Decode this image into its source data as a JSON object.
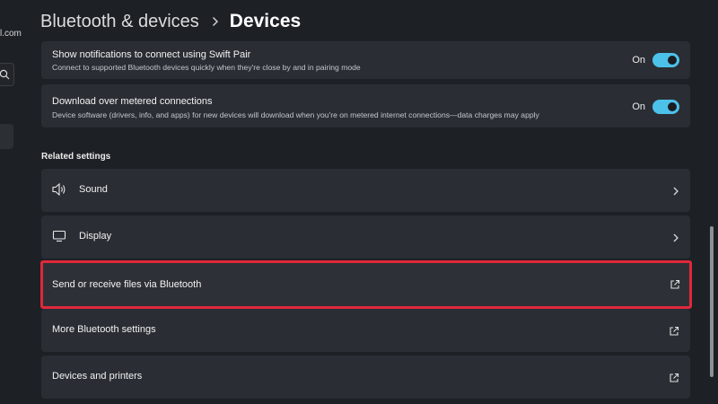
{
  "sidebar": {
    "account_email_fragment": "l.com",
    "search_icon": "search-icon"
  },
  "header": {
    "parent": "Bluetooth & devices",
    "separator_icon": "chevron-right-icon",
    "current": "Devices"
  },
  "toggle_settings": [
    {
      "title": "Show notifications to connect using Swift Pair",
      "description": "Connect to supported Bluetooth devices quickly when they're close by and in pairing mode",
      "state": "On"
    },
    {
      "title": "Download over metered connections",
      "description": "Device software (drivers, info, and apps) for new devices will download when you're on metered internet connections—data charges may apply",
      "state": "On"
    }
  ],
  "related_settings": {
    "title": "Related settings",
    "items": [
      {
        "label": "Sound",
        "icon": "speaker-icon",
        "end_icon": "chevron-right-icon"
      },
      {
        "label": "Display",
        "icon": "monitor-icon",
        "end_icon": "chevron-right-icon"
      },
      {
        "label": "Send or receive files via Bluetooth",
        "end_icon": "open-external-icon",
        "highlighted": true
      },
      {
        "label": "More Bluetooth settings",
        "end_icon": "open-external-icon"
      },
      {
        "label": "Devices and printers",
        "end_icon": "open-external-icon"
      }
    ]
  },
  "colors": {
    "background": "#1d2025",
    "card": "#2a2e34",
    "toggle_on": "#4cc2ea",
    "highlight_border": "#e0283b"
  }
}
